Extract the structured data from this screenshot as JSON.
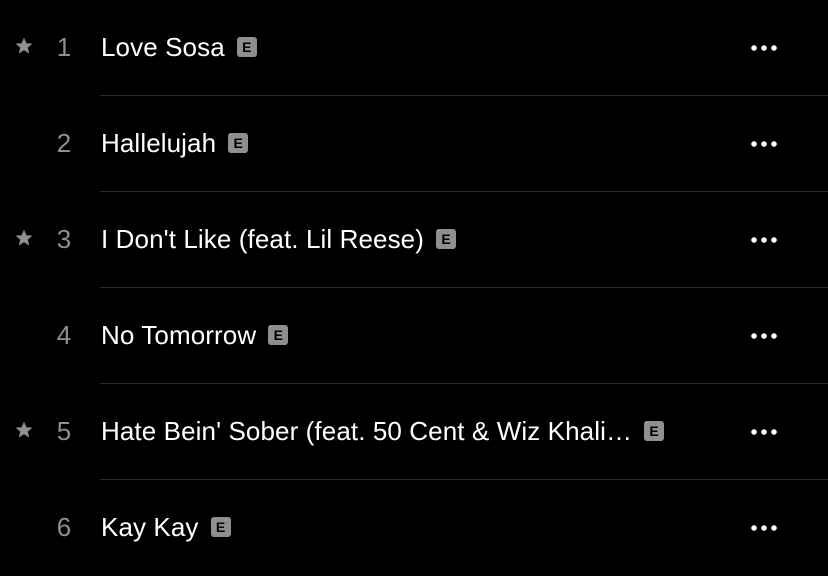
{
  "icons": {
    "favorite": "star-icon",
    "more": "ellipsis-icon",
    "explicit": "explicit-badge"
  },
  "colors": {
    "background": "#000000",
    "title": "#ffffff",
    "secondary": "#8e8e93",
    "separator": "#2c2c2e"
  },
  "tracks": [
    {
      "number": "1",
      "title": "Love Sosa",
      "explicit": "E",
      "starred": true
    },
    {
      "number": "2",
      "title": "Hallelujah",
      "explicit": "E",
      "starred": false
    },
    {
      "number": "3",
      "title": "I Don't Like (feat. Lil Reese)",
      "explicit": "E",
      "starred": true
    },
    {
      "number": "4",
      "title": "No Tomorrow",
      "explicit": "E",
      "starred": false
    },
    {
      "number": "5",
      "title": "Hate Bein' Sober (feat. 50 Cent & Wiz Khali…",
      "explicit": "E",
      "starred": true
    },
    {
      "number": "6",
      "title": "Kay Kay",
      "explicit": "E",
      "starred": false
    }
  ]
}
